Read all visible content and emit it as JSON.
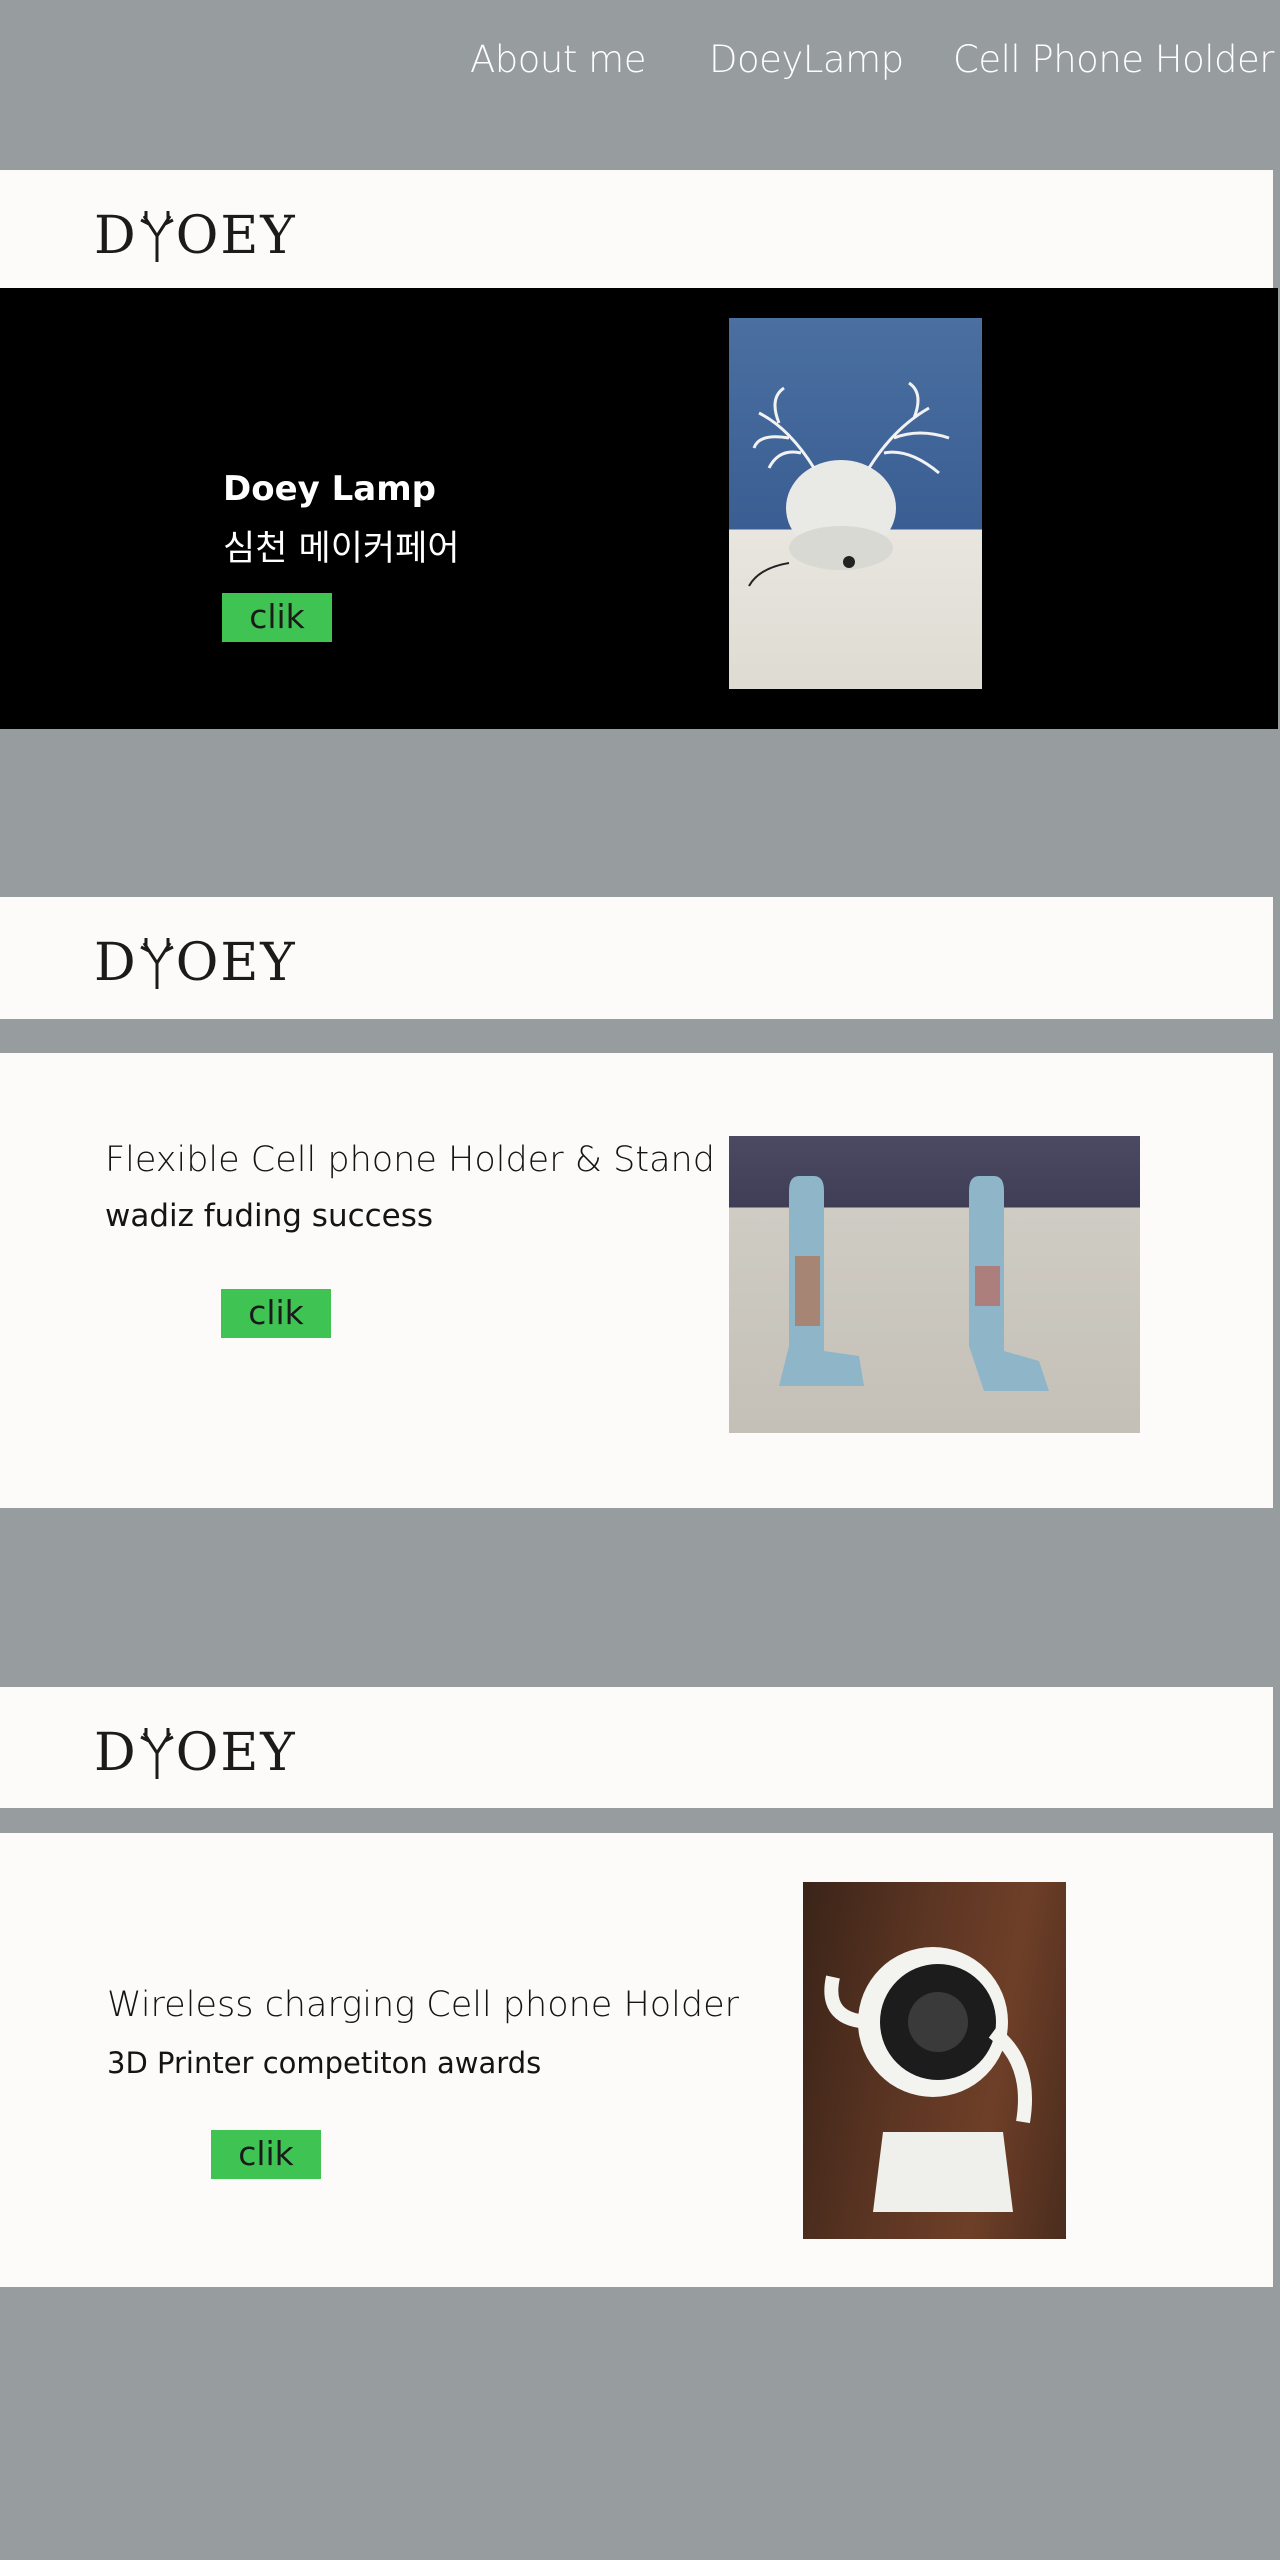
{
  "nav": {
    "items": [
      "About me",
      "DoeyLamp",
      "Cell Phone Holder"
    ]
  },
  "logo": {
    "prefix": "D",
    "suffix": "OEY"
  },
  "lamp_section": {
    "title": "Doey Lamp",
    "subtitle": "심천 메이커페어",
    "button": "clik"
  },
  "holder_section": {
    "title": "Flexible Cell phone Holder & Stand",
    "subtitle": "wadiz fuding success",
    "button": "clik"
  },
  "wireless_section": {
    "title": "Wireless charging Cell phone Holder",
    "subtitle": "3D Printer competiton awards",
    "button": "clik"
  },
  "colors": {
    "page_bg": "#979c9f",
    "panel_bg": "#fcfbf9",
    "button_green": "#3fc454",
    "hero_black": "#000000"
  }
}
